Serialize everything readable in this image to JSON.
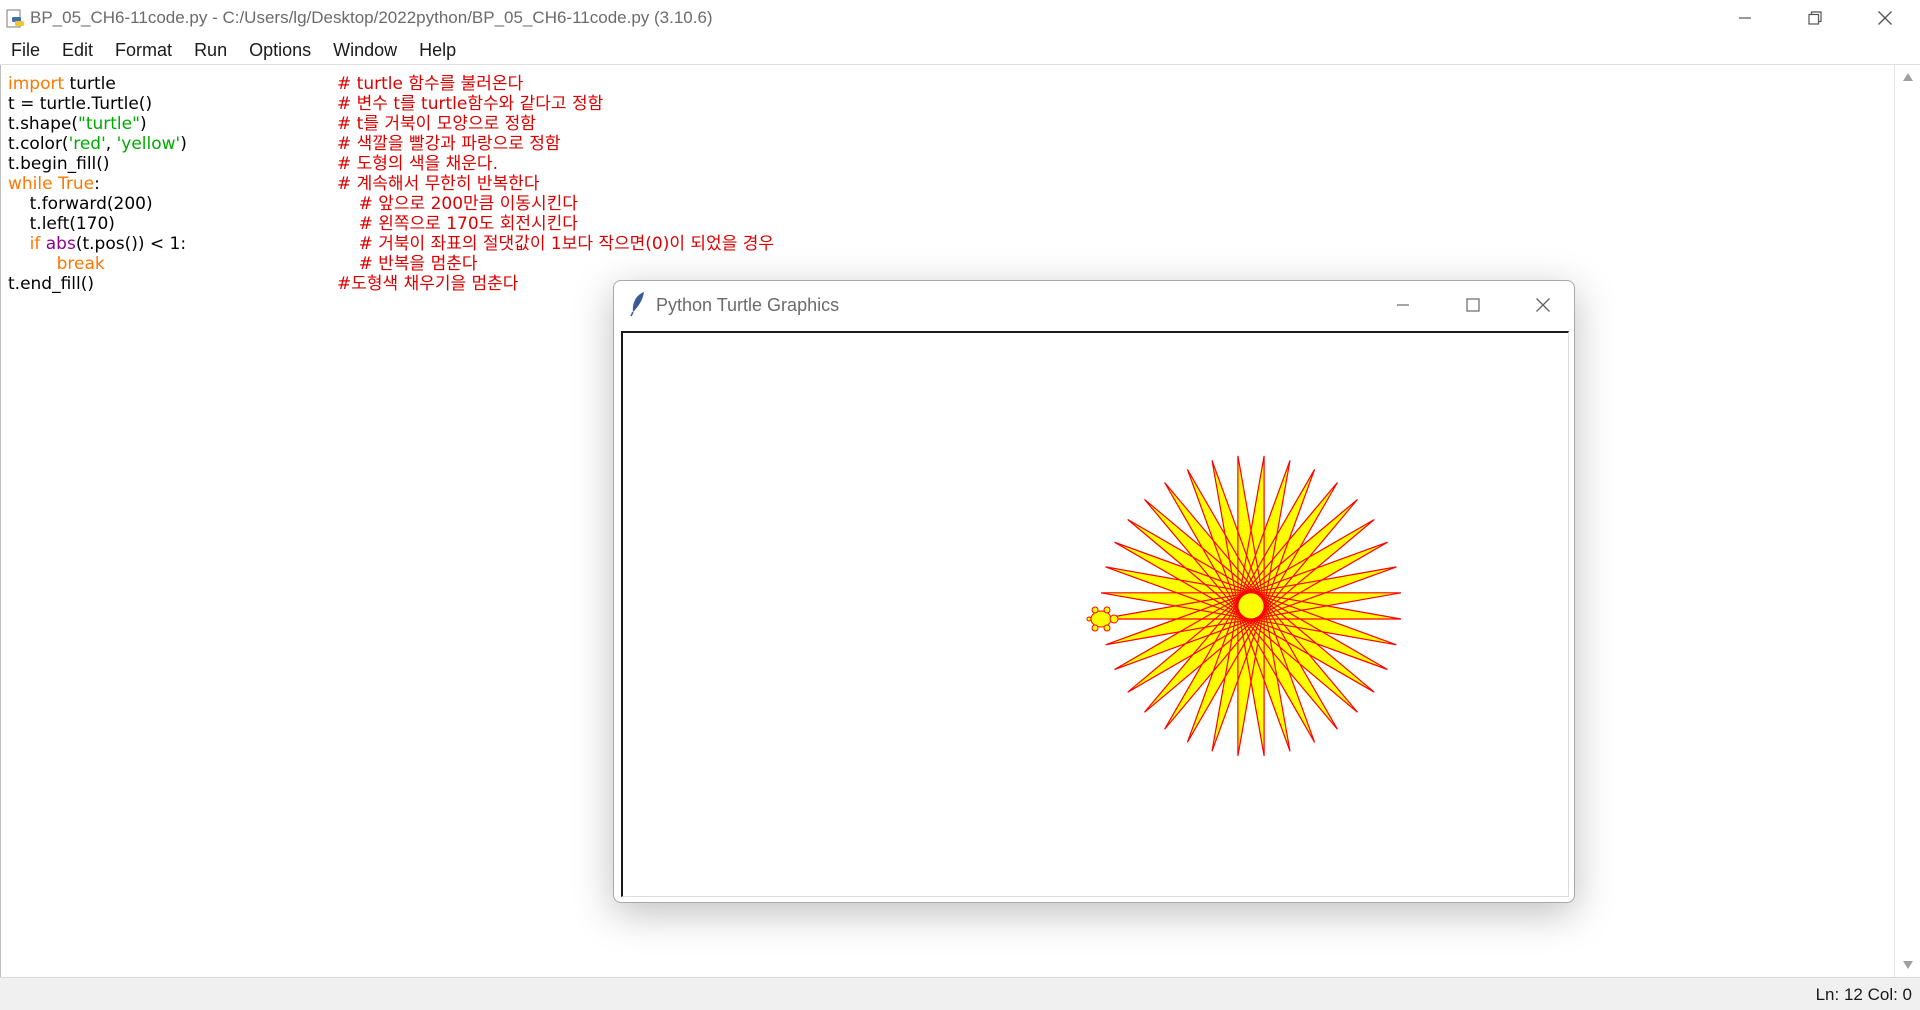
{
  "window": {
    "title": "BP_05_CH6-11code.py - C:/Users/lg/Desktop/2022python/BP_05_CH6-11code.py (3.10.6)"
  },
  "menu": [
    "File",
    "Edit",
    "Format",
    "Run",
    "Options",
    "Window",
    "Help"
  ],
  "code": {
    "lines": [
      {
        "indent": "",
        "parts": [
          {
            "t": "import",
            "c": "kw"
          },
          {
            "t": " turtle",
            "c": ""
          }
        ]
      },
      {
        "indent": "",
        "parts": [
          {
            "t": "t = turtle.Turtle()",
            "c": ""
          }
        ]
      },
      {
        "indent": "",
        "parts": [
          {
            "t": "t.shape(",
            "c": ""
          },
          {
            "t": "\"turtle\"",
            "c": "str"
          },
          {
            "t": ")",
            "c": ""
          }
        ]
      },
      {
        "indent": "",
        "parts": [
          {
            "t": "t.color(",
            "c": ""
          },
          {
            "t": "'red'",
            "c": "str"
          },
          {
            "t": ", ",
            "c": ""
          },
          {
            "t": "'yellow'",
            "c": "str"
          },
          {
            "t": ")",
            "c": ""
          }
        ]
      },
      {
        "indent": "",
        "parts": [
          {
            "t": "t.begin_fill()",
            "c": ""
          }
        ]
      },
      {
        "indent": "",
        "parts": [
          {
            "t": "while",
            "c": "kw"
          },
          {
            "t": " ",
            "c": ""
          },
          {
            "t": "True",
            "c": "kw"
          },
          {
            "t": ":",
            "c": ""
          }
        ]
      },
      {
        "indent": "    ",
        "parts": [
          {
            "t": "t.forward(200)",
            "c": ""
          }
        ]
      },
      {
        "indent": "    ",
        "parts": [
          {
            "t": "t.left(170)",
            "c": ""
          }
        ]
      },
      {
        "indent": "    ",
        "parts": [
          {
            "t": "if",
            "c": "kw"
          },
          {
            "t": " ",
            "c": ""
          },
          {
            "t": "abs",
            "c": "bi"
          },
          {
            "t": "(t.pos()) < 1:",
            "c": ""
          }
        ]
      },
      {
        "indent": "         ",
        "parts": [
          {
            "t": "break",
            "c": "kw"
          }
        ]
      },
      {
        "indent": "",
        "parts": [
          {
            "t": "t.end_fill()",
            "c": ""
          }
        ]
      }
    ],
    "comments": [
      {
        "indent": "",
        "text": "# turtle 함수를 불러온다"
      },
      {
        "indent": "",
        "text": "# 변수 t를 turtle함수와 같다고 정함"
      },
      {
        "indent": "",
        "text": "# t를 거북이 모양으로 정함"
      },
      {
        "indent": "",
        "text": "# 색깔을 빨강과 파랑으로 정함"
      },
      {
        "indent": "",
        "text": "# 도형의 색을 채운다."
      },
      {
        "indent": "",
        "text": "# 계속해서 무한히 반복한다"
      },
      {
        "indent": "    ",
        "text": "# 앞으로 200만큼 이동시킨다"
      },
      {
        "indent": "    ",
        "text": "# 왼쪽으로 170도 회전시킨다"
      },
      {
        "indent": "    ",
        "text": "# 거북이 좌표의 절댓값이 1보다 작으면(0)이 되었을 경우"
      },
      {
        "indent": "    ",
        "text": "# 반복을 멈춘다"
      },
      {
        "indent": "",
        "text": "#도형색 채우기을 멈춘다"
      }
    ]
  },
  "status": {
    "text": "Ln: 12  Col: 0"
  },
  "turtle_window": {
    "title": "Python Turtle Graphics",
    "drawing": {
      "pen_color": "#ff0000",
      "fill_color": "#ffff00",
      "forward": 200,
      "left_angle": 170
    }
  },
  "colors": {
    "keyword": "#ff7700",
    "string": "#00aa00",
    "builtin": "#900090",
    "comment": "#dd0000"
  }
}
